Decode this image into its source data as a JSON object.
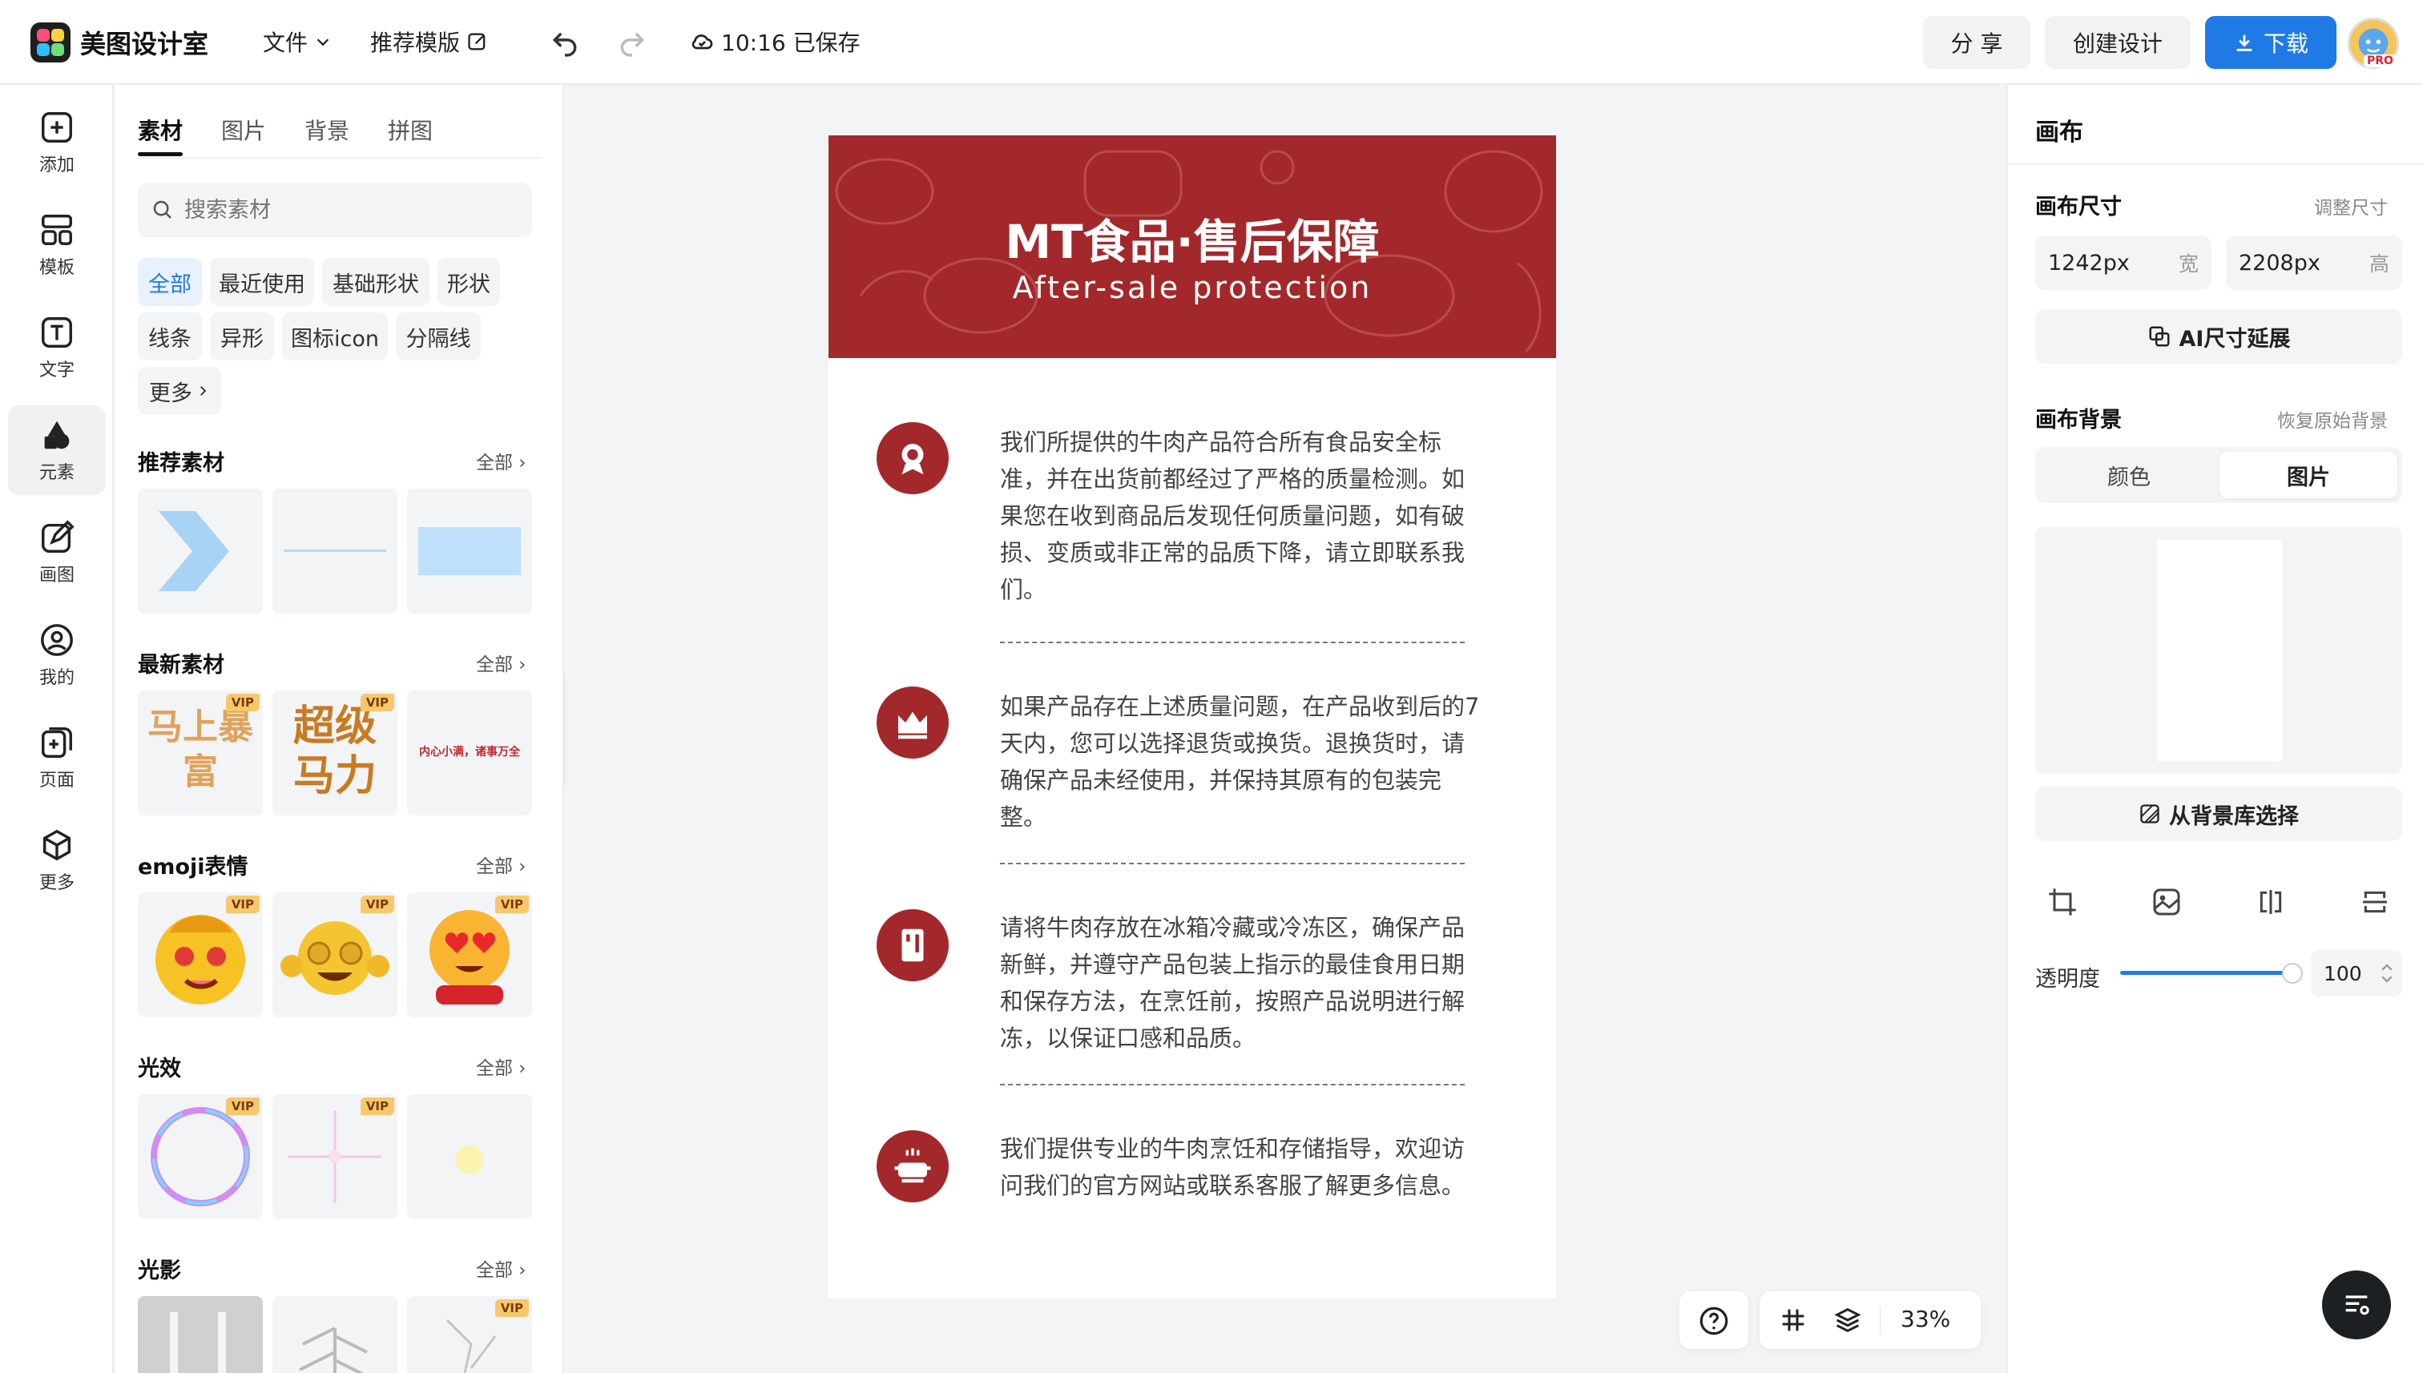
{
  "app": {
    "name": "美图设计室"
  },
  "topbar": {
    "file_menu": "文件",
    "templates": "推荐模版",
    "save_status": "10:16 已保存",
    "share": "分 享",
    "create": "创建设计",
    "download": "下载",
    "pro_badge": "PRO"
  },
  "rail": {
    "items": [
      {
        "label": "添加"
      },
      {
        "label": "模板"
      },
      {
        "label": "文字"
      },
      {
        "label": "元素"
      },
      {
        "label": "画图"
      },
      {
        "label": "我的"
      },
      {
        "label": "页面"
      },
      {
        "label": "更多"
      }
    ]
  },
  "panel": {
    "tabs": [
      "素材",
      "图片",
      "背景",
      "拼图"
    ],
    "search_placeholder": "搜索素材",
    "chips": [
      "全部",
      "最近使用",
      "基础形状",
      "形状",
      "线条",
      "异形",
      "图标icon",
      "分隔线",
      "更多"
    ],
    "vip_label": "VIP",
    "sections": [
      {
        "title": "推荐素材",
        "all": "全部"
      },
      {
        "title": "最新素材",
        "all": "全部"
      },
      {
        "title": "emoji表情",
        "all": "全部"
      },
      {
        "title": "光效",
        "all": "全部"
      },
      {
        "title": "光影",
        "all": "全部"
      }
    ],
    "tile_texts": {
      "t1": "马上暴富",
      "t2": "超级马力",
      "t3": "内心小满，诸事万全"
    }
  },
  "poster": {
    "title": "MT食品·售后保障",
    "subtitle": "After-sale protection",
    "items": [
      {
        "text": "我们所提供的牛肉产品符合所有食品安全标准，并在出货前都经过了严格的质量检测。如果您在收到商品后发现任何质量问题，如有破损、变质或非正常的品质下降，请立即联系我们。"
      },
      {
        "text": "如果产品存在上述质量问题，在产品收到后的7天内，您可以选择退货或换货。退换货时，请确保产品未经使用，并保持其原有的包装完整。"
      },
      {
        "text": "请将牛肉存放在冰箱冷藏或冷冻区，确保产品新鲜，并遵守产品包装上指示的最佳食用日期和保存方法，在烹饪前，按照产品说明进行解冻，以保证口感和品质。"
      },
      {
        "text": "我们提供专业的牛肉烹饪和存储指导，欢迎访问我们的官方网站或联系客服了解更多信息。"
      }
    ],
    "accent": "#a3282b"
  },
  "canvas_tools": {
    "zoom": "33%"
  },
  "right": {
    "title": "画布",
    "size_label": "画布尺寸",
    "resize_link": "调整尺寸",
    "width_value": "1242px",
    "width_unit": "宽",
    "height_value": "2208px",
    "height_unit": "高",
    "ai_extend": "AI尺寸延展",
    "bg_label": "画布背景",
    "restore_bg": "恢复原始背景",
    "seg_color": "颜色",
    "seg_image": "图片",
    "from_library": "从背景库选择",
    "opacity_label": "透明度",
    "opacity_value": "100",
    "opacity_fraction": 1.0
  },
  "colors": {
    "primary": "#1f7ae6",
    "poster_red": "#a3282b"
  }
}
